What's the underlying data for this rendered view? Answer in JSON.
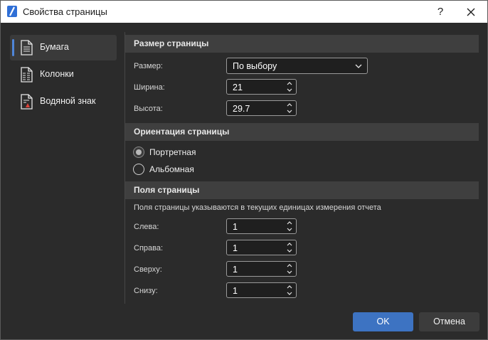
{
  "window": {
    "title": "Свойства страницы",
    "help_label": "?"
  },
  "sidebar": {
    "items": [
      {
        "label": "Бумага",
        "icon": "paper-icon",
        "selected": true
      },
      {
        "label": "Колонки",
        "icon": "columns-icon",
        "selected": false
      },
      {
        "label": "Водяной знак",
        "icon": "watermark-icon",
        "selected": false
      }
    ]
  },
  "page_size": {
    "heading": "Размер страницы",
    "size_label": "Размер:",
    "size_value": "По выбору",
    "width_label": "Ширина:",
    "width_value": "21",
    "height_label": "Высота:",
    "height_value": "29.7"
  },
  "orientation": {
    "heading": "Ориентация страницы",
    "portrait_label": "Портретная",
    "landscape_label": "Альбомная",
    "selected": "portrait"
  },
  "margins": {
    "heading": "Поля страницы",
    "note": "Поля страницы указываются в текущих единицах измерения отчета",
    "left_label": "Слева:",
    "left_value": "1",
    "right_label": "Справа:",
    "right_value": "1",
    "top_label": "Сверху:",
    "top_value": "1",
    "bottom_label": "Снизу:",
    "bottom_value": "1"
  },
  "buttons": {
    "ok": "OK",
    "cancel": "Отмена"
  },
  "colors": {
    "accent": "#3d73c2",
    "background": "#2b2b2b",
    "section": "#3f3f3f"
  }
}
